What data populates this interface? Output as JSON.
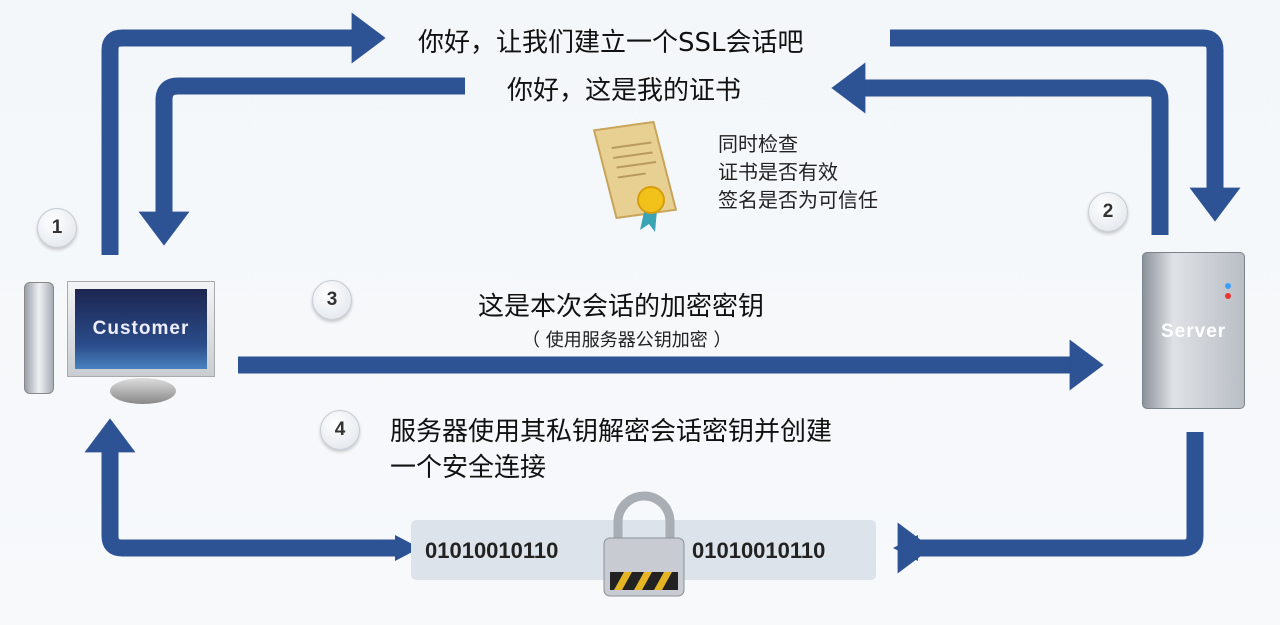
{
  "messages": {
    "step1": "你好，让我们建立一个SSL会话吧",
    "step2": "你好，这是我的证书",
    "check_lines": [
      "同时检查",
      "证书是否有效",
      "签名是否为可信任"
    ],
    "step3": "这是本次会话的加密密钥",
    "step3_note": "（ 使用服务器公钥加密 ）",
    "step4_lines": [
      "服务器使用其私钥解密会话密钥并创建",
      "一个安全连接"
    ]
  },
  "badges": [
    "1",
    "2",
    "3",
    "4"
  ],
  "client_label": "Customer",
  "server_label": "Server",
  "encrypted_data": [
    "01010010110",
    "01010010110"
  ],
  "colors": {
    "arrow": "#2d5394",
    "background": "#f5f8fa"
  }
}
